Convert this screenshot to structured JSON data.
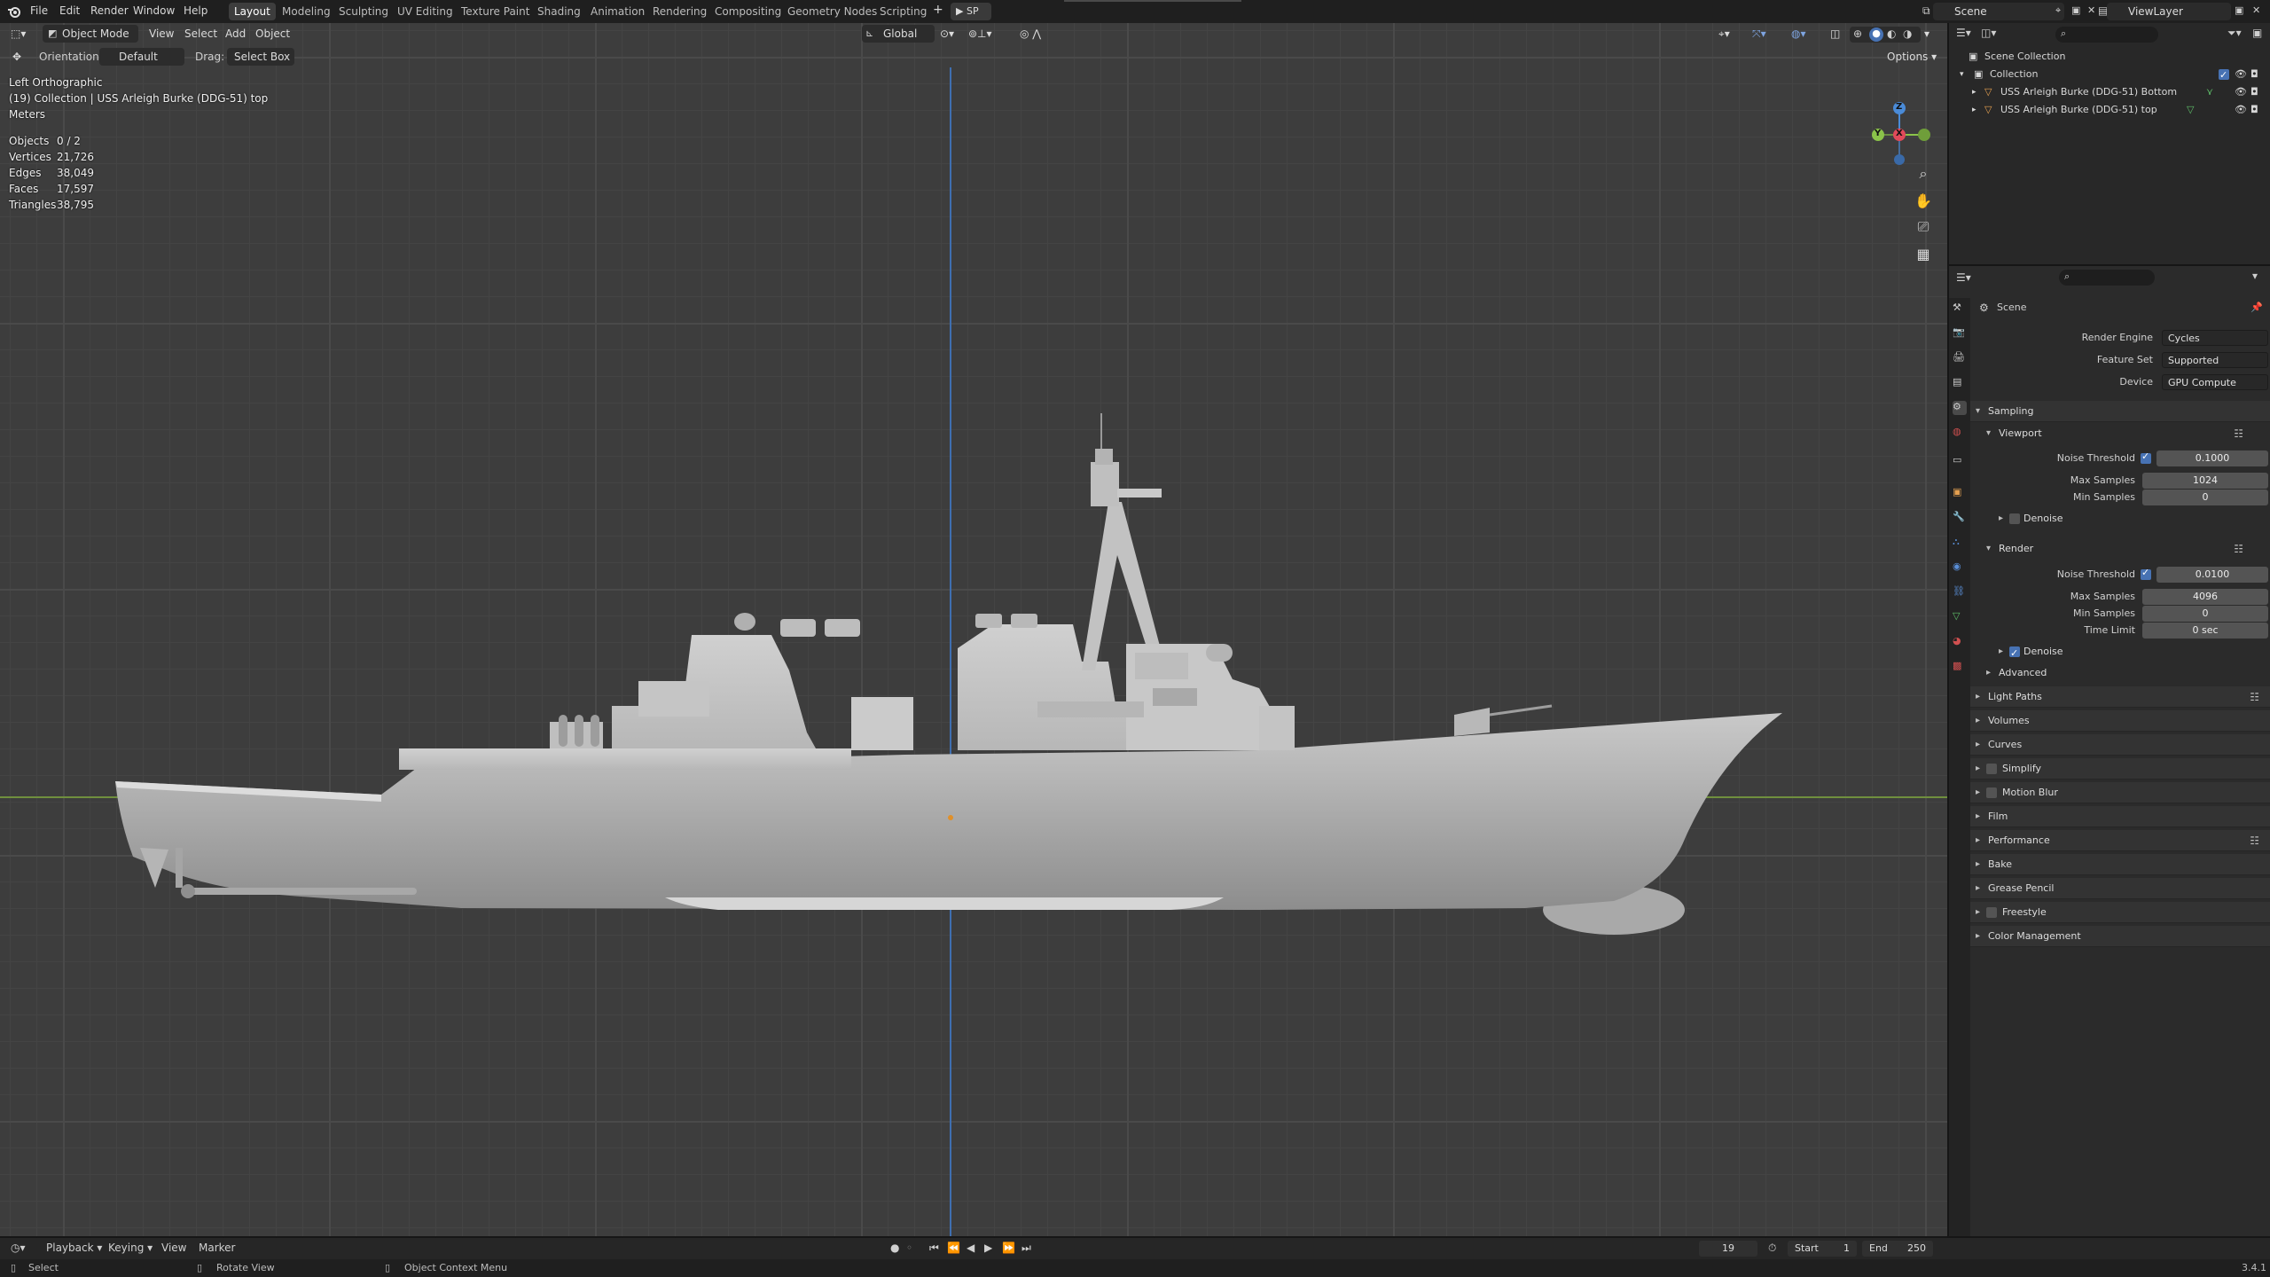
{
  "menu": {
    "file": "File",
    "edit": "Edit",
    "render": "Render",
    "window": "Window",
    "help": "Help"
  },
  "workspaces": [
    "Layout",
    "Modeling",
    "Sculpting",
    "UV Editing",
    "Texture Paint",
    "Shading",
    "Animation",
    "Rendering",
    "Compositing",
    "Geometry Nodes",
    "Scripting"
  ],
  "active_workspace": "Layout",
  "topbar_right": {
    "play_label": "SP",
    "scene": "Scene",
    "view_layer": "ViewLayer"
  },
  "viewport_header": {
    "mode": "Object Mode",
    "view": "View",
    "select": "Select",
    "add": "Add",
    "object": "Object",
    "transform_orientation": "Global",
    "orientation_label": "Orientation:",
    "orientation_value": "Default",
    "drag_label": "Drag:",
    "drag_value": "Select Box",
    "options": "Options"
  },
  "viewport_overlay": {
    "view_name": "Left Orthographic",
    "collection_line": "(19) Collection | USS Arleigh Burke (DDG-51) top",
    "units": "Meters",
    "stats": [
      {
        "label": "Objects",
        "value": "0 / 2"
      },
      {
        "label": "Vertices",
        "value": "21,726"
      },
      {
        "label": "Edges",
        "value": "38,049"
      },
      {
        "label": "Faces",
        "value": "17,597"
      },
      {
        "label": "Triangles",
        "value": "38,795"
      }
    ]
  },
  "gizmo": {
    "z": "Z",
    "y": "Y",
    "x": "X"
  },
  "outliner": {
    "scene_collection": "Scene Collection",
    "collection": "Collection",
    "items": [
      "USS Arleigh Burke (DDG-51) Bottom",
      "USS Arleigh Burke (DDG-51) top"
    ]
  },
  "properties": {
    "context": "Scene",
    "render_engine_label": "Render Engine",
    "render_engine": "Cycles",
    "feature_set_label": "Feature Set",
    "feature_set": "Supported",
    "device_label": "Device",
    "device": "GPU Compute",
    "sampling": "Sampling",
    "viewport": "Viewport",
    "vp_noise_threshold_label": "Noise Threshold",
    "vp_noise_threshold": "0.1000",
    "vp_max_samples_label": "Max Samples",
    "vp_max_samples": "1024",
    "vp_min_samples_label": "Min Samples",
    "vp_min_samples": "0",
    "vp_denoise": "Denoise",
    "render": "Render",
    "r_noise_threshold_label": "Noise Threshold",
    "r_noise_threshold": "0.0100",
    "r_max_samples_label": "Max Samples",
    "r_max_samples": "4096",
    "r_min_samples_label": "Min Samples",
    "r_min_samples": "0",
    "r_time_limit_label": "Time Limit",
    "r_time_limit": "0 sec",
    "r_denoise": "Denoise",
    "advanced": "Advanced",
    "panels": [
      "Light Paths",
      "Volumes",
      "Curves",
      "Simplify",
      "Motion Blur",
      "Film",
      "Performance",
      "Bake",
      "Grease Pencil",
      "Freestyle",
      "Color Management"
    ]
  },
  "timeline": {
    "playback": "Playback",
    "keying": "Keying",
    "view": "View",
    "marker": "Marker",
    "current_frame": "19",
    "start_label": "Start",
    "start": "1",
    "end_label": "End",
    "end": "250"
  },
  "statusbar": {
    "select": "Select",
    "rotate_view": "Rotate View",
    "context_menu": "Object Context Menu",
    "version": "3.4.1"
  },
  "colors": {
    "accent": "#4772b3",
    "x_axis": "#e04a5a",
    "y_axis": "#8bc34a",
    "z_axis": "#4a8bd8"
  }
}
